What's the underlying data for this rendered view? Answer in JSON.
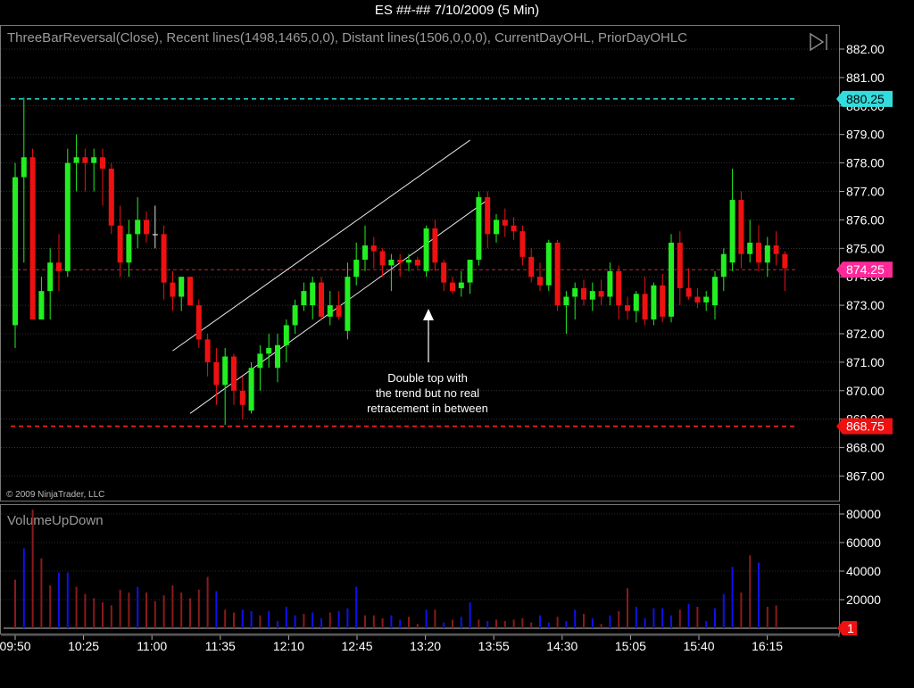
{
  "title": "ES ##-##  7/10/2009 (5 Min)",
  "indicator_label": "ThreeBarReversal(Close),  Recent  lines(1498,1465,0,0),  Distant  lines(1506,0,0,0),  CurrentDayOHL,  PriorDayOHLC",
  "copyright": "© 2009 NinjaTrader, LLC",
  "volume_label": "VolumeUpDown",
  "annotation": [
    "Double top with",
    "the trend but no real",
    "retracement in between"
  ],
  "colors": {
    "up": "#22ee22",
    "down": "#ee1111",
    "neutral": "#dddddd",
    "vol_up": "#1010ee",
    "vol_down": "#8b1a1a",
    "cyan_line": "#22c8c8",
    "red_line": "#ff2020",
    "magenta_line": "#b03040",
    "cyan_badge": "#33dddd",
    "magenta_badge": "#ff2a9a",
    "red_badge": "#ee1111",
    "grid": "#555555"
  },
  "chart_data": [
    {
      "type": "candlestick",
      "ylim": [
        866.5,
        882.5
      ],
      "yticks": [
        "882.00",
        "881.00",
        "880.00",
        "879.00",
        "878.00",
        "877.00",
        "876.00",
        "875.00",
        "874.00",
        "873.00",
        "872.00",
        "871.00",
        "870.00",
        "869.00",
        "868.00",
        "867.00"
      ],
      "xticks": [
        "09:50",
        "10:25",
        "11:00",
        "11:35",
        "12:10",
        "12:45",
        "13:20",
        "13:55",
        "14:30",
        "15:05",
        "15:40",
        "16:15"
      ],
      "horizontal_lines": [
        {
          "value": 880.25,
          "style": "dashed",
          "color": "cyan",
          "label": "880.25"
        },
        {
          "value": 874.25,
          "style": "dashed",
          "color": "magenta",
          "label": "874.25"
        },
        {
          "value": 868.75,
          "style": "dashed",
          "color": "red",
          "label": "868.75"
        }
      ],
      "channel_lines": [
        {
          "from": [
            18,
            871.4
          ],
          "to": [
            52,
            878.8
          ]
        },
        {
          "from": [
            20,
            869.2
          ],
          "to": [
            54,
            876.7
          ]
        }
      ],
      "candles": [
        [
          872.3,
          878.0,
          871.5,
          877.5
        ],
        [
          877.5,
          880.3,
          874.5,
          878.2
        ],
        [
          878.2,
          878.5,
          874.0,
          872.5
        ],
        [
          872.5,
          874.0,
          872.5,
          873.5
        ],
        [
          873.5,
          875.0,
          872.5,
          874.5
        ],
        [
          874.5,
          875.5,
          873.5,
          874.2
        ],
        [
          874.2,
          878.5,
          874.0,
          878.0
        ],
        [
          878.0,
          879.0,
          877.0,
          878.2
        ],
        [
          878.2,
          878.5,
          877.0,
          878.0
        ],
        [
          878.0,
          878.5,
          877.0,
          878.2
        ],
        [
          878.2,
          878.5,
          876.5,
          877.8
        ],
        [
          877.8,
          878.0,
          875.5,
          875.8
        ],
        [
          875.8,
          876.5,
          874.0,
          874.5
        ],
        [
          874.5,
          876.0,
          874.0,
          875.5
        ],
        [
          875.5,
          876.8,
          875.0,
          876.0
        ],
        [
          876.0,
          876.3,
          875.2,
          875.5
        ],
        [
          875.5,
          876.5,
          875.0,
          875.5
        ],
        [
          875.5,
          875.8,
          873.2,
          873.8
        ],
        [
          873.8,
          874.2,
          872.8,
          873.3
        ],
        [
          873.3,
          874.0,
          872.8,
          874.0
        ],
        [
          874.0,
          874.0,
          873.0,
          873.0
        ],
        [
          873.0,
          873.2,
          871.5,
          871.8
        ],
        [
          871.8,
          872.0,
          870.5,
          871.0
        ],
        [
          871.0,
          871.5,
          869.5,
          870.2
        ],
        [
          870.2,
          871.5,
          868.8,
          871.2
        ],
        [
          871.2,
          871.3,
          869.5,
          870.0
        ],
        [
          870.0,
          870.5,
          869.0,
          869.5
        ],
        [
          869.3,
          871.0,
          869.2,
          870.8
        ],
        [
          870.8,
          871.6,
          870.0,
          871.3
        ],
        [
          871.3,
          872.0,
          870.8,
          871.5
        ],
        [
          870.8,
          872.0,
          870.3,
          871.6
        ],
        [
          871.6,
          872.5,
          871.0,
          872.3
        ],
        [
          872.3,
          873.2,
          872.0,
          873.0
        ],
        [
          873.0,
          873.8,
          872.8,
          873.5
        ],
        [
          873.0,
          874.0,
          872.5,
          873.8
        ],
        [
          873.8,
          874.0,
          872.5,
          872.6
        ],
        [
          872.6,
          873.5,
          872.3,
          873.0
        ],
        [
          873.0,
          873.5,
          872.5,
          872.6
        ],
        [
          872.1,
          874.5,
          871.8,
          874.0
        ],
        [
          874.0,
          875.2,
          873.7,
          874.6
        ],
        [
          874.6,
          875.8,
          874.2,
          875.1
        ],
        [
          875.1,
          875.4,
          874.3,
          874.9
        ],
        [
          874.9,
          875.0,
          874.0,
          874.4
        ],
        [
          874.4,
          874.8,
          873.5,
          874.6
        ],
        [
          874.6,
          874.8,
          874.0,
          874.5
        ],
        [
          874.5,
          874.8,
          874.2,
          874.6
        ],
        [
          874.6,
          874.7,
          874.3,
          874.4
        ],
        [
          874.2,
          875.8,
          874.0,
          875.7
        ],
        [
          875.7,
          876.0,
          874.2,
          874.5
        ],
        [
          874.5,
          874.6,
          873.5,
          873.8
        ],
        [
          873.8,
          874.0,
          873.4,
          873.5
        ],
        [
          873.6,
          874.2,
          873.3,
          873.8
        ],
        [
          873.8,
          874.5,
          873.4,
          874.6
        ],
        [
          874.6,
          877.0,
          874.4,
          876.8
        ],
        [
          876.8,
          877.0,
          875.0,
          875.5
        ],
        [
          875.5,
          876.2,
          875.2,
          876.0
        ],
        [
          876.0,
          876.4,
          875.4,
          875.8
        ],
        [
          875.8,
          876.1,
          875.3,
          875.6
        ],
        [
          875.6,
          875.8,
          874.4,
          874.7
        ],
        [
          874.7,
          875.0,
          873.8,
          874.0
        ],
        [
          874.0,
          874.5,
          873.5,
          873.7
        ],
        [
          873.7,
          875.3,
          873.5,
          875.2
        ],
        [
          875.2,
          875.3,
          872.8,
          873.0
        ],
        [
          873.0,
          873.5,
          872.0,
          873.3
        ],
        [
          873.3,
          873.8,
          872.5,
          873.6
        ],
        [
          873.6,
          873.9,
          873.0,
          873.2
        ],
        [
          873.2,
          873.8,
          872.8,
          873.5
        ],
        [
          873.5,
          873.9,
          873.0,
          873.3
        ],
        [
          873.3,
          874.5,
          873.0,
          874.2
        ],
        [
          874.2,
          874.4,
          872.5,
          873.0
        ],
        [
          873.0,
          873.3,
          872.5,
          872.8
        ],
        [
          872.8,
          873.5,
          872.4,
          873.4
        ],
        [
          873.4,
          874.0,
          872.3,
          872.5
        ],
        [
          872.5,
          873.8,
          872.3,
          873.7
        ],
        [
          873.7,
          874.1,
          872.4,
          872.6
        ],
        [
          872.6,
          875.5,
          872.4,
          875.2
        ],
        [
          875.2,
          875.6,
          873.0,
          873.6
        ],
        [
          873.6,
          874.3,
          873.2,
          873.3
        ],
        [
          873.3,
          873.6,
          872.9,
          873.1
        ],
        [
          873.1,
          873.5,
          872.8,
          873.3
        ],
        [
          873.0,
          874.2,
          872.5,
          874.0
        ],
        [
          874.0,
          875.0,
          873.5,
          874.8
        ],
        [
          874.5,
          877.8,
          874.2,
          876.7
        ],
        [
          876.7,
          877.0,
          874.3,
          874.8
        ],
        [
          874.8,
          876.0,
          874.5,
          875.2
        ],
        [
          875.2,
          875.8,
          874.2,
          874.5
        ],
        [
          874.5,
          875.4,
          874.0,
          875.1
        ],
        [
          875.1,
          875.6,
          874.4,
          874.8
        ],
        [
          874.8,
          874.9,
          873.5,
          874.3
        ]
      ]
    },
    {
      "type": "bar",
      "name": "VolumeUpDown",
      "ylim": [
        0,
        85000
      ],
      "yticks": [
        "80000",
        "60000",
        "40000",
        "20000"
      ],
      "last_value": "1",
      "values": [
        34000,
        56000,
        83000,
        49000,
        30000,
        39000,
        39000,
        29000,
        24000,
        21000,
        18000,
        16000,
        27000,
        25000,
        29000,
        25000,
        19000,
        23000,
        30000,
        25000,
        21000,
        27000,
        36000,
        26000,
        13000,
        11000,
        13000,
        12000,
        9000,
        12000,
        5000,
        15000,
        9000,
        10000,
        11000,
        7000,
        11000,
        12000,
        14000,
        29000,
        9000,
        9000,
        7000,
        9000,
        6000,
        8000,
        3000,
        13000,
        13000,
        4000,
        6000,
        8000,
        18000,
        6000,
        5000,
        6000,
        5000,
        6000,
        7000,
        4000,
        9000,
        4000,
        8000,
        5000,
        13000,
        10000,
        7000,
        3000,
        9000,
        12000,
        28000,
        15000,
        7000,
        14000,
        14000,
        9000,
        13000,
        17000,
        15000,
        5000,
        14000,
        24000,
        43000,
        25000,
        51000,
        46000,
        15000,
        16000
      ],
      "up": [
        0,
        1,
        0,
        0,
        0,
        1,
        1,
        0,
        0,
        0,
        0,
        0,
        0,
        0,
        1,
        0,
        0,
        0,
        0,
        0,
        0,
        0,
        0,
        1,
        0,
        0,
        1,
        1,
        0,
        1,
        1,
        1,
        1,
        0,
        1,
        1,
        0,
        1,
        1,
        1,
        0,
        0,
        0,
        1,
        1,
        0,
        0,
        1,
        0,
        1,
        0,
        1,
        1,
        0,
        1,
        0,
        0,
        0,
        0,
        0,
        1,
        1,
        0,
        1,
        1,
        0,
        1,
        0,
        1,
        0,
        0,
        1,
        1,
        1,
        1,
        1,
        0,
        1,
        0,
        1,
        1,
        1,
        1,
        0,
        0,
        1,
        0,
        0
      ]
    }
  ]
}
